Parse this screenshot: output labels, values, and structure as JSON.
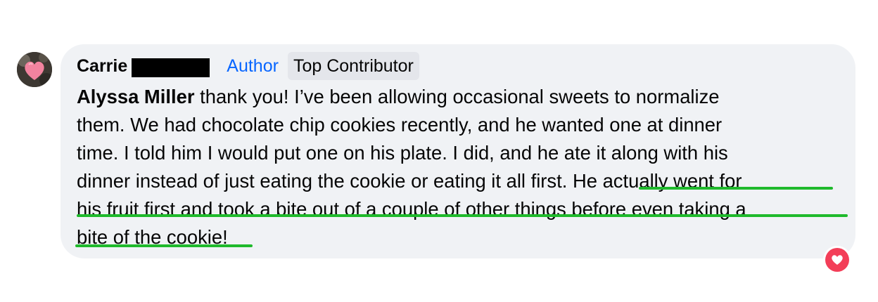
{
  "comment": {
    "author_name": "Carrie",
    "author_badge": "Author",
    "contributor_badge": "Top Contributor",
    "mention": "Alyssa Miller",
    "lines": [
      " thank you! I’ve been allowing occasional sweets to normalize",
      "them. We had chocolate chip cookies recently, and he wanted one at dinner",
      "time. I told him I would put one on his plate. I did, and he ate it along with his",
      "dinner instead of just eating the cookie or eating it all first. He actually went for",
      "his fruit first and took a bite out of a couple of other things before even taking a",
      "bite of the cookie!"
    ]
  },
  "colors": {
    "highlight_underline": "#1fba2c",
    "author_badge": "#0866ff",
    "bubble_background": "#f0f2f5",
    "reaction_love": "#f33e58"
  },
  "icons": {
    "avatar": "pink-heart-avatar",
    "reaction": "love-reaction-icon"
  }
}
